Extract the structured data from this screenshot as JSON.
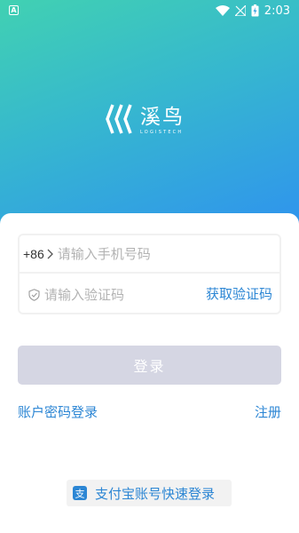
{
  "status_bar": {
    "time": "2:03",
    "app_icon_glyph": "A",
    "icons": [
      "wifi-icon",
      "no-signal-icon",
      "battery-charging-icon"
    ]
  },
  "brand": {
    "name": "溪鸟",
    "subtitle": "LOGISTECH",
    "gradient_colors": [
      "#41d1b2",
      "#2f93ee"
    ]
  },
  "login_form": {
    "country_code": "+86",
    "phone_placeholder": "请输入手机号码",
    "code_placeholder": "请输入验证码",
    "get_code_label": "获取验证码",
    "submit_label": "登录"
  },
  "links": {
    "password_login": "账户密码登录",
    "register": "注册"
  },
  "alipay": {
    "label": "支付宝账号快速登录"
  },
  "colors": {
    "link": "#2c86d4",
    "button_disabled": "#d5d6e3"
  }
}
